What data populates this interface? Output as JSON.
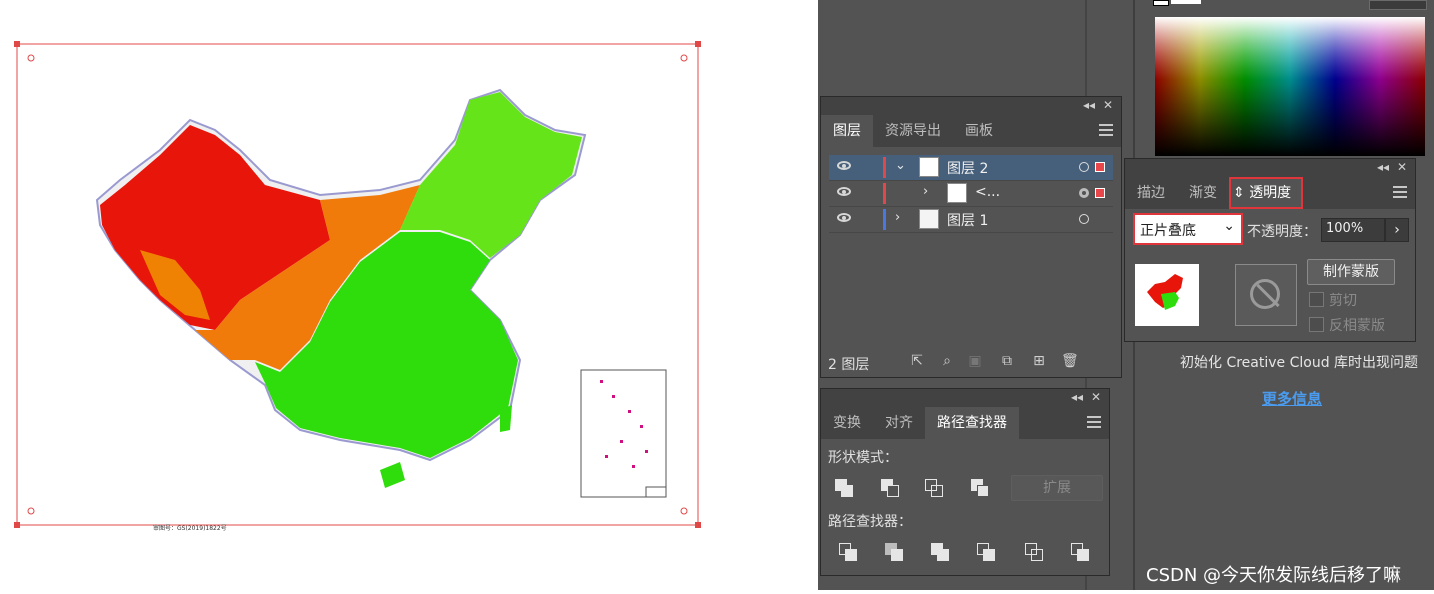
{
  "layers_panel": {
    "tabs": [
      "图层",
      "资源导出",
      "画板"
    ],
    "layers": [
      {
        "name": "图层 2",
        "expanded": true
      },
      {
        "name": "<...",
        "expanded": false
      },
      {
        "name": "图层 1",
        "expanded": false
      }
    ],
    "footer_count": "2 图层"
  },
  "transform_panel": {
    "tabs": [
      "变换",
      "对齐",
      "路径查找器"
    ],
    "shape_modes_label": "形状模式：",
    "expand_label": "扩展",
    "pathfinders_label": "路径查找器："
  },
  "transparency_panel": {
    "tabs": [
      "描边",
      "渐变",
      "透明度"
    ],
    "tab_prefix": "⇕",
    "blend_mode": "正片叠底",
    "opacity_label": "不透明度：",
    "opacity_value": "100%",
    "make_mask_label": "制作蒙版",
    "clip_label": "剪切",
    "invert_mask_label": "反相蒙版"
  },
  "libraries_panel": {
    "message": "初始化 Creative Cloud 库时出现问题",
    "more_info": "更多信息"
  },
  "watermark": "CSDN @今天你发际线后移了嘛",
  "map_footnote": "审图号：GS(2019)1822号",
  "colors": {
    "panel_bg": "#535353",
    "panel_dark": "#424242",
    "selection": "#46607c",
    "highlight": "#e0353a",
    "link": "#4a9cf0"
  }
}
